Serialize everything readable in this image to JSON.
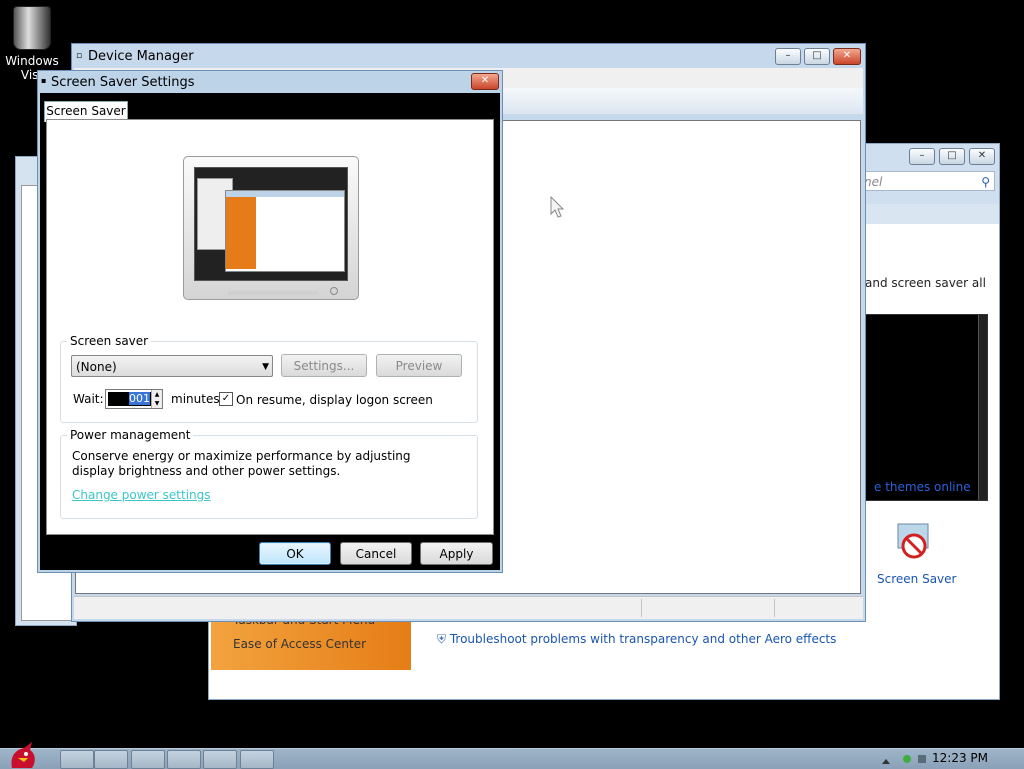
{
  "desktop": {
    "recycle_label": "Windows Vist"
  },
  "control_panel": {
    "search_placeholder": "nel",
    "description": "and screen saver all",
    "themes_link": "e themes online",
    "screen_saver_label": "Screen Saver",
    "sidebar_items": [
      "Taskbar and Start Menu",
      "Ease of Access Center"
    ],
    "troubleshoot_link": "Troubleshoot problems with transparency and other Aero effects"
  },
  "device_manager": {
    "title": "Device Manager"
  },
  "screen_saver_dialog": {
    "title": "Screen Saver Settings",
    "tab": "Screen Saver",
    "screen_saver_group": "Screen saver",
    "selected_saver": "(None)",
    "settings_button": "Settings...",
    "preview_button": "Preview",
    "wait_label": "Wait:",
    "wait_value": "001",
    "minutes_label": "minutes",
    "resume_label": "On resume, display logon screen",
    "resume_checked": true,
    "power_group": "Power management",
    "power_text": "Conserve energy or maximize performance by adjusting display brightness and other power settings.",
    "power_link": "Change power settings",
    "ok_button": "OK",
    "cancel_button": "Cancel",
    "apply_button": "Apply"
  },
  "taskbar": {
    "clock": "12:23 PM"
  }
}
